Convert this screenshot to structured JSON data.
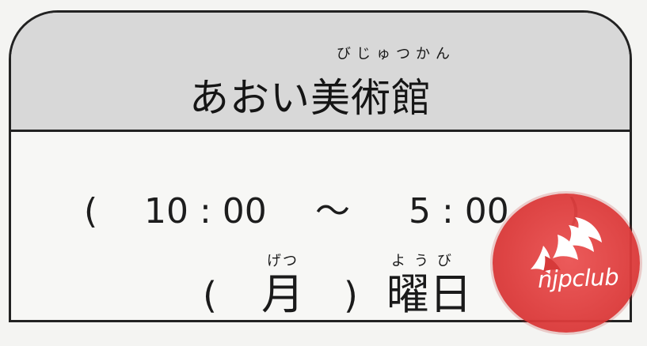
{
  "sign": {
    "title": "あおい美術館",
    "title_reading": "びじゅつかん",
    "hours": {
      "open_paren": "(",
      "open_time": "10 : 00",
      "tilde": "〜",
      "close_time": "5 : 00",
      "close_paren": ")"
    },
    "closed_day": {
      "open_paren": "(",
      "day": "月",
      "day_reading": "げつ",
      "close_paren": ")",
      "suffix": "曜日",
      "suffix_reading": "ようび"
    }
  },
  "watermark": {
    "text": "njpclub",
    "icon": "bird-feather-icon",
    "color": "#e04545"
  }
}
